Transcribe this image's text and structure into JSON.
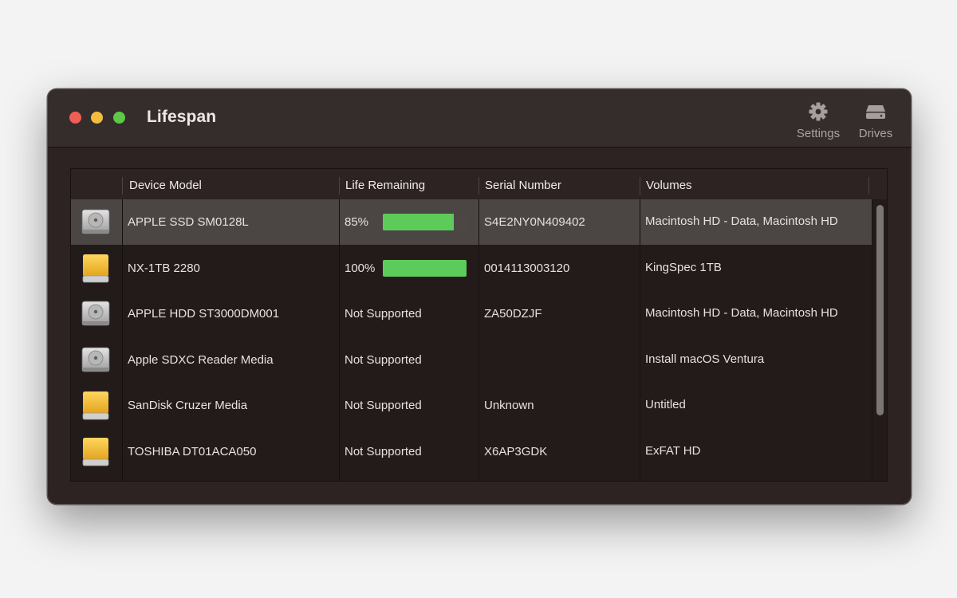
{
  "window": {
    "title": "Lifespan",
    "toolbar": {
      "settings": {
        "label": "Settings",
        "icon": "gear-icon"
      },
      "drives": {
        "label": "Drives",
        "icon": "drive-icon"
      }
    }
  },
  "colors": {
    "accent_bar": "#5dcb5a",
    "traffic_close": "#ee5f58",
    "traffic_minimize": "#f2bd3d",
    "traffic_maximize": "#5ec946"
  },
  "table": {
    "columns": [
      "",
      "Device Model",
      "Life Remaining",
      "Serial Number",
      "Volumes"
    ],
    "rows": [
      {
        "icon": "internal-drive-icon",
        "model": "APPLE SSD SM0128L",
        "life": "85%",
        "life_fraction": 0.85,
        "serial": "S4E2NY0N409402",
        "volumes": "Macintosh HD - Data, Macintosh HD",
        "selected": true
      },
      {
        "icon": "external-drive-icon",
        "model": "NX-1TB 2280",
        "life": "100%",
        "life_fraction": 1.0,
        "serial": "0014113003120",
        "volumes": "KingSpec 1TB",
        "selected": false
      },
      {
        "icon": "internal-drive-icon",
        "model": "APPLE HDD ST3000DM001",
        "life": "Not Supported",
        "life_fraction": null,
        "serial": "ZA50DZJF",
        "volumes": "Macintosh HD - Data, Macintosh HD",
        "selected": false
      },
      {
        "icon": "internal-drive-icon",
        "model": "Apple SDXC Reader Media",
        "life": "Not Supported",
        "life_fraction": null,
        "serial": "",
        "volumes": "Install macOS Ventura",
        "selected": false
      },
      {
        "icon": "external-drive-icon",
        "model": "SanDisk Cruzer Media",
        "life": "Not Supported",
        "life_fraction": null,
        "serial": "Unknown",
        "volumes": "Untitled",
        "selected": false
      },
      {
        "icon": "external-drive-icon",
        "model": "TOSHIBA DT01ACA050",
        "life": "Not Supported",
        "life_fraction": null,
        "serial": "X6AP3GDK",
        "volumes": "ExFAT HD",
        "selected": false
      }
    ]
  }
}
